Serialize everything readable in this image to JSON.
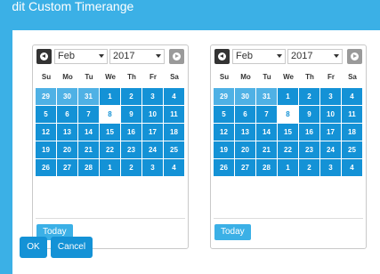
{
  "dialog": {
    "title": "Edit Custom Timerange"
  },
  "calendars": [
    {
      "month": "Feb",
      "year": "2017",
      "weekdays": [
        "Su",
        "Mo",
        "Tu",
        "We",
        "Th",
        "Fr",
        "Sa"
      ],
      "weeks": [
        [
          "29",
          "30",
          "31",
          "1",
          "2",
          "3",
          "4"
        ],
        [
          "5",
          "6",
          "7",
          "8",
          "9",
          "10",
          "11"
        ],
        [
          "12",
          "13",
          "14",
          "15",
          "16",
          "17",
          "18"
        ],
        [
          "19",
          "20",
          "21",
          "22",
          "23",
          "24",
          "25"
        ],
        [
          "26",
          "27",
          "28",
          "1",
          "2",
          "3",
          "4"
        ]
      ],
      "today_label": "Today"
    },
    {
      "month": "Feb",
      "year": "2017",
      "weekdays": [
        "Su",
        "Mo",
        "Tu",
        "We",
        "Th",
        "Fr",
        "Sa"
      ],
      "weeks": [
        [
          "29",
          "30",
          "31",
          "1",
          "2",
          "3",
          "4"
        ],
        [
          "5",
          "6",
          "7",
          "8",
          "9",
          "10",
          "11"
        ],
        [
          "12",
          "13",
          "14",
          "15",
          "16",
          "17",
          "18"
        ],
        [
          "19",
          "20",
          "21",
          "22",
          "23",
          "24",
          "25"
        ],
        [
          "26",
          "27",
          "28",
          "1",
          "2",
          "3",
          "4"
        ]
      ],
      "today_label": "Today"
    }
  ],
  "actions": {
    "ok_label": "OK",
    "cancel_label": "Cancel"
  },
  "colors": {
    "title_bar": "#3bb0e6",
    "day_cell": "#1492d6",
    "other_month_cell": "#4fb1e5"
  }
}
